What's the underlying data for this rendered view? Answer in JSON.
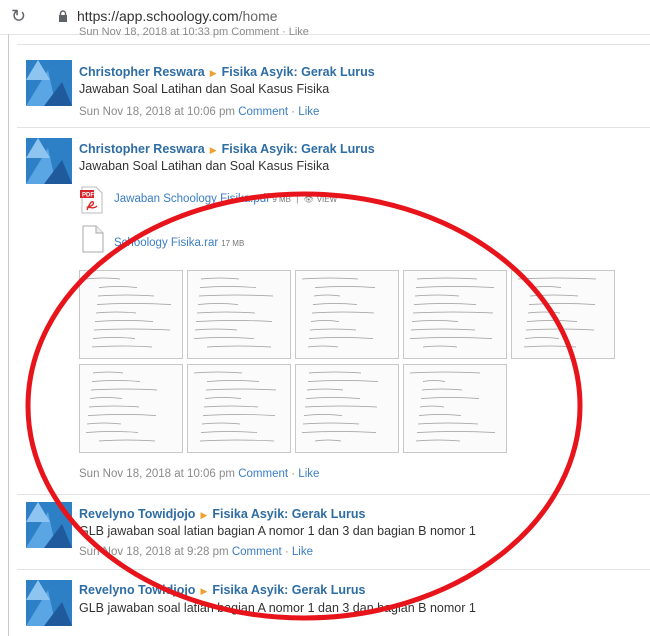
{
  "browser": {
    "url_host": "https://app.schoology.com",
    "url_path": "/home"
  },
  "feed": {
    "partial_meta": "Sun Nov 18, 2018 at 10:33 pm  Comment · Like",
    "posts": [
      {
        "author": "Christopher Reswara",
        "group": "Fisika Asyik: Gerak Lurus",
        "body": "Jawaban Soal Latihan dan Soal Kasus Fisika",
        "timestamp": "Sun Nov 18, 2018 at 10:06 pm",
        "comment": "Comment",
        "like": "Like"
      },
      {
        "author": "Christopher Reswara",
        "group": "Fisika Asyik: Gerak Lurus",
        "body": "Jawaban Soal Latihan dan Soal Kasus Fisika",
        "timestamp": "Sun Nov 18, 2018 at 10:06 pm",
        "comment": "Comment",
        "like": "Like",
        "attachments": [
          {
            "name": "Jawaban Schoology Fisika.pdf",
            "size": "9 MB",
            "action": "VIEW",
            "icon": "pdf-icon"
          },
          {
            "name": "Schoology Fisika.rar",
            "size": "17 MB",
            "icon": "file-icon"
          }
        ],
        "thumbnail_count": 9
      },
      {
        "author": "Revelyno Towidjojo",
        "group": "Fisika Asyik: Gerak Lurus",
        "body": "GLB jawaban soal latian bagian A nomor 1 dan 3 dan bagian B nomor 1",
        "timestamp": "Sun Nov 18, 2018 at 9:28 pm",
        "comment": "Comment",
        "like": "Like"
      },
      {
        "author": "Revelyno Towidjojo",
        "group": "Fisika Asyik: Gerak Lurus",
        "body": "GLB jawaban soal latian bagian A nomor 1 dan 3 dan bagian B nomor 1"
      }
    ]
  },
  "annotation": {
    "shape": "ellipse",
    "color": "#e8141b"
  },
  "colors": {
    "link": "#2e6da4",
    "arrow": "#f0a030",
    "avatar": "#2d7fc6"
  }
}
